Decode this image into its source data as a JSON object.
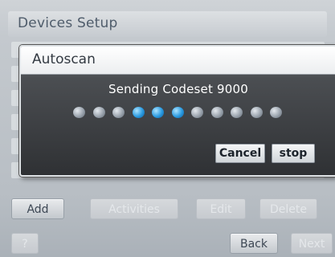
{
  "window": {
    "title": "Devices Setup"
  },
  "dialog": {
    "title": "Autoscan",
    "status": "Sending Codeset 9000",
    "progress": {
      "total_dots": 11,
      "active_dots": [
        3,
        4,
        5
      ]
    },
    "buttons": {
      "cancel": "Cancel",
      "stop": "stop"
    }
  },
  "toolbar": {
    "add": "Add",
    "activities": "Activities",
    "edit": "Edit",
    "delete": "Delete"
  },
  "footer": {
    "help": "?",
    "back": "Back",
    "next": "Next"
  },
  "colors": {
    "active_dot": "#2a9ae0",
    "dialog_bg": "#3f4246"
  }
}
